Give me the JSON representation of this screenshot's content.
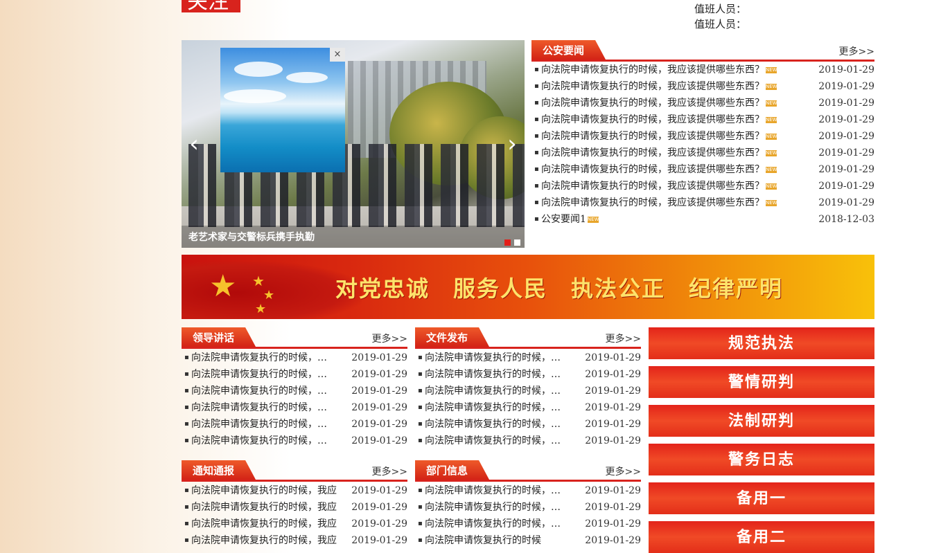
{
  "header": {
    "logo_fragment": "关注",
    "duty_line1": "值班人员：",
    "duty_line2": "值班人员："
  },
  "slider": {
    "caption": "老艺术家与交警标兵携手执勤",
    "prev_label": "‹",
    "next_label": "›",
    "active_slide": 1,
    "slide_count": 2
  },
  "popup": {
    "close_label": "×"
  },
  "news": {
    "title": "公安要闻",
    "more": "更多>>",
    "items": [
      {
        "text": "向法院申请恢复执行的时候，我应该提供哪些东西？",
        "date": "2019-01-29",
        "new": "NEW"
      },
      {
        "text": "向法院申请恢复执行的时候，我应该提供哪些东西？",
        "date": "2019-01-29",
        "new": "NEW"
      },
      {
        "text": "向法院申请恢复执行的时候，我应该提供哪些东西？",
        "date": "2019-01-29",
        "new": "NEW"
      },
      {
        "text": "向法院申请恢复执行的时候，我应该提供哪些东西？",
        "date": "2019-01-29",
        "new": "NEW"
      },
      {
        "text": "向法院申请恢复执行的时候，我应该提供哪些东西？",
        "date": "2019-01-29",
        "new": "NEW"
      },
      {
        "text": "向法院申请恢复执行的时候，我应该提供哪些东西？",
        "date": "2019-01-29",
        "new": "NEW"
      },
      {
        "text": "向法院申请恢复执行的时候，我应该提供哪些东西？",
        "date": "2019-01-29",
        "new": "NEW"
      },
      {
        "text": "向法院申请恢复执行的时候，我应该提供哪些东西？",
        "date": "2019-01-29",
        "new": "NEW"
      },
      {
        "text": "向法院申请恢复执行的时候，我应该提供哪些东西？",
        "date": "2019-01-29",
        "new": "NEW"
      },
      {
        "text": "公安要闻1",
        "date": "2018-12-03",
        "new": "NEW"
      }
    ]
  },
  "banner": {
    "slogan": "对党忠诚　服务人民　执法公正　纪律严明"
  },
  "leader": {
    "title": "领导讲话",
    "more": "更多>>",
    "items": [
      {
        "text": "向法院申请恢复执行的时候，…",
        "date": "2019-01-29"
      },
      {
        "text": "向法院申请恢复执行的时候，…",
        "date": "2019-01-29"
      },
      {
        "text": "向法院申请恢复执行的时候，…",
        "date": "2019-01-29"
      },
      {
        "text": "向法院申请恢复执行的时候，…",
        "date": "2019-01-29"
      },
      {
        "text": "向法院申请恢复执行的时候，…",
        "date": "2019-01-29"
      },
      {
        "text": "向法院申请恢复执行的时候，…",
        "date": "2019-01-29"
      }
    ]
  },
  "docs": {
    "title": "文件发布",
    "more": "更多>>",
    "items": [
      {
        "text": "向法院申请恢复执行的时候，…",
        "date": "2019-01-29"
      },
      {
        "text": "向法院申请恢复执行的时候，…",
        "date": "2019-01-29"
      },
      {
        "text": "向法院申请恢复执行的时候，…",
        "date": "2019-01-29"
      },
      {
        "text": "向法院申请恢复执行的时候，…",
        "date": "2019-01-29"
      },
      {
        "text": "向法院申请恢复执行的时候，…",
        "date": "2019-01-29"
      },
      {
        "text": "向法院申请恢复执行的时候，…",
        "date": "2019-01-29"
      }
    ]
  },
  "notice": {
    "title": "通知通报",
    "more": "更多>>",
    "items": [
      {
        "text": "向法院申请恢复执行的时候，我应",
        "date": "2019-01-29"
      },
      {
        "text": "向法院申请恢复执行的时候，我应",
        "date": "2019-01-29"
      },
      {
        "text": "向法院申请恢复执行的时候，我应",
        "date": "2019-01-29"
      },
      {
        "text": "向法院申请恢复执行的时候，我应",
        "date": "2019-01-29"
      }
    ]
  },
  "dept": {
    "title": "部门信息",
    "more": "更多>>",
    "items": [
      {
        "text": "向法院申请恢复执行的时候，…",
        "date": "2019-01-29"
      },
      {
        "text": "向法院申请恢复执行的时候，…",
        "date": "2019-01-29"
      },
      {
        "text": "向法院申请恢复执行的时候，…",
        "date": "2019-01-29"
      },
      {
        "text": "向法院申请恢复执行的时候",
        "date": "2019-01-29"
      }
    ]
  },
  "nav_buttons": [
    {
      "label": "规范执法"
    },
    {
      "label": "警情研判"
    },
    {
      "label": "法制研判"
    },
    {
      "label": "警务日志"
    },
    {
      "label": "备用一"
    },
    {
      "label": "备用二"
    }
  ],
  "colors": {
    "accent_red": "#d8231d",
    "new_tag": "#e8a52a"
  }
}
